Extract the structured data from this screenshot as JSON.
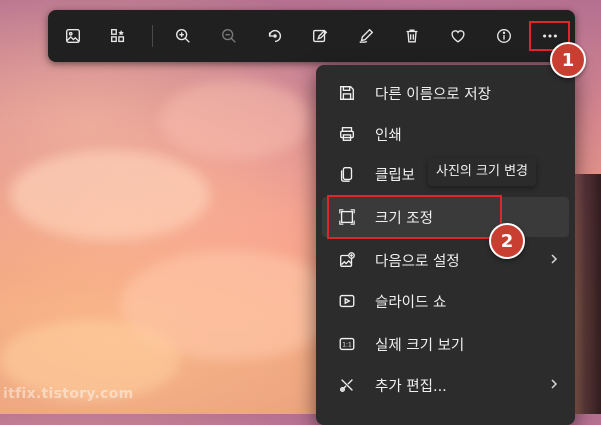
{
  "toolbar": {
    "buttons": [
      {
        "name": "image-icon"
      },
      {
        "name": "gallery-icon"
      },
      {
        "name": "zoom-in-icon"
      },
      {
        "name": "zoom-out-icon"
      },
      {
        "name": "rotate-icon"
      },
      {
        "name": "edit-image-icon"
      },
      {
        "name": "draw-icon"
      },
      {
        "name": "delete-icon"
      },
      {
        "name": "favorite-icon"
      },
      {
        "name": "info-icon"
      },
      {
        "name": "more-options-icon"
      }
    ]
  },
  "menu": {
    "items": [
      {
        "label": "다른 이름으로 저장",
        "icon": "save-icon"
      },
      {
        "label": "인쇄",
        "icon": "print-icon"
      },
      {
        "label": "클립보",
        "icon": "copy-icon"
      },
      {
        "label": "크기 조정",
        "icon": "resize-icon"
      },
      {
        "label": "다음으로 설정",
        "icon": "set-as-icon"
      },
      {
        "label": "슬라이드 쇼",
        "icon": "slideshow-icon"
      },
      {
        "label": "실제 크기 보기",
        "icon": "actual-size-icon"
      },
      {
        "label": "추가 편집...",
        "icon": "more-edit-icon"
      }
    ]
  },
  "tooltip": {
    "text": "사진의 크기 변경"
  },
  "annotations": {
    "badge1": "1",
    "badge2": "2"
  },
  "watermark": "itfix.tistory.com",
  "colors": {
    "highlight": "#e0262b",
    "badge": "#c83f32",
    "toolbar": "#202020",
    "menu": "#2c2c2c"
  }
}
